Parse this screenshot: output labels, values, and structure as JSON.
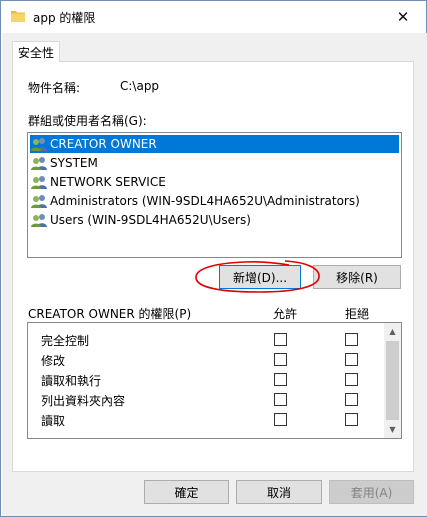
{
  "window": {
    "title": "app 的權限",
    "close_symbol": "✕"
  },
  "tabs": [
    "安全性"
  ],
  "object": {
    "label": "物件名稱:",
    "value": "C:\\app"
  },
  "groups": {
    "label": "群組或使用者名稱(G):",
    "items": [
      {
        "name": "CREATOR OWNER",
        "selected": true
      },
      {
        "name": "SYSTEM",
        "selected": false
      },
      {
        "name": "NETWORK SERVICE",
        "selected": false
      },
      {
        "name": "Administrators (WIN-9SDL4HA652U\\Administrators)",
        "selected": false
      },
      {
        "name": "Users (WIN-9SDL4HA652U\\Users)",
        "selected": false
      }
    ],
    "icon": "users-icon"
  },
  "buttons": {
    "add": "新增(D)...",
    "remove": "移除(R)",
    "ok": "確定",
    "cancel": "取消",
    "apply": "套用(A)"
  },
  "permissions": {
    "header": "CREATOR OWNER 的權限(P)",
    "allow": "允許",
    "deny": "拒絕",
    "rows": [
      {
        "name": "完全控制",
        "allow": false,
        "deny": false
      },
      {
        "name": "修改",
        "allow": false,
        "deny": false
      },
      {
        "name": "讀取和執行",
        "allow": false,
        "deny": false
      },
      {
        "name": "列出資料夾內容",
        "allow": false,
        "deny": false
      },
      {
        "name": "讀取",
        "allow": false,
        "deny": false
      }
    ]
  },
  "colors": {
    "selection": "#0078d7",
    "annotation": "#e00000"
  }
}
